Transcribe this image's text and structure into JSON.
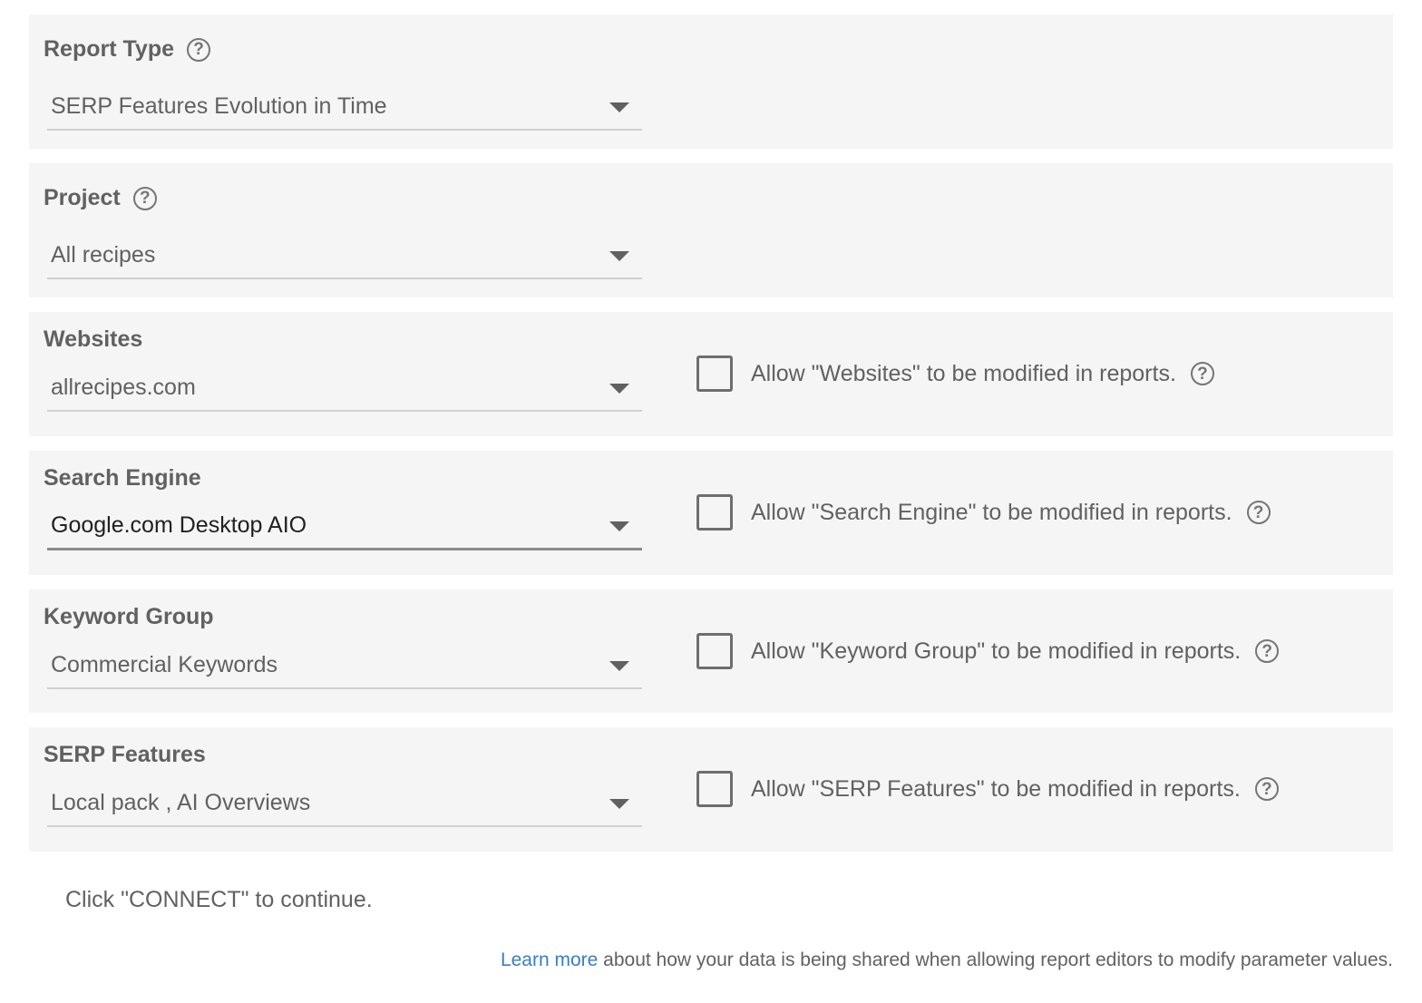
{
  "fields": {
    "report_type": {
      "label": "Report Type",
      "value": "SERP Features Evolution in Time"
    },
    "project": {
      "label": "Project",
      "value": "All recipes"
    },
    "websites": {
      "label": "Websites",
      "value": "allrecipes.com",
      "allow_text": "Allow \"Websites\" to be modified in reports."
    },
    "search_engine": {
      "label": "Search Engine",
      "value": "Google.com Desktop AIO",
      "allow_text": "Allow \"Search Engine\" to be modified in reports."
    },
    "keyword_group": {
      "label": "Keyword Group",
      "value": "Commercial Keywords",
      "allow_text": "Allow \"Keyword Group\" to be modified in reports."
    },
    "serp_features": {
      "label": "SERP Features",
      "value": "Local pack , AI Overviews",
      "allow_text": "Allow \"SERP Features\" to be modified in reports."
    }
  },
  "help_glyph": "?",
  "footer": {
    "connect_note": "Click \"CONNECT\" to continue.",
    "learn_more_link": "Learn more",
    "learn_more_rest": " about how your data is being shared when allowing report editors to modify parameter values."
  },
  "colors": {
    "panel_bg": "#f5f5f5",
    "text": "#616161",
    "active_text": "#212121",
    "link": "#3a7dc3"
  }
}
